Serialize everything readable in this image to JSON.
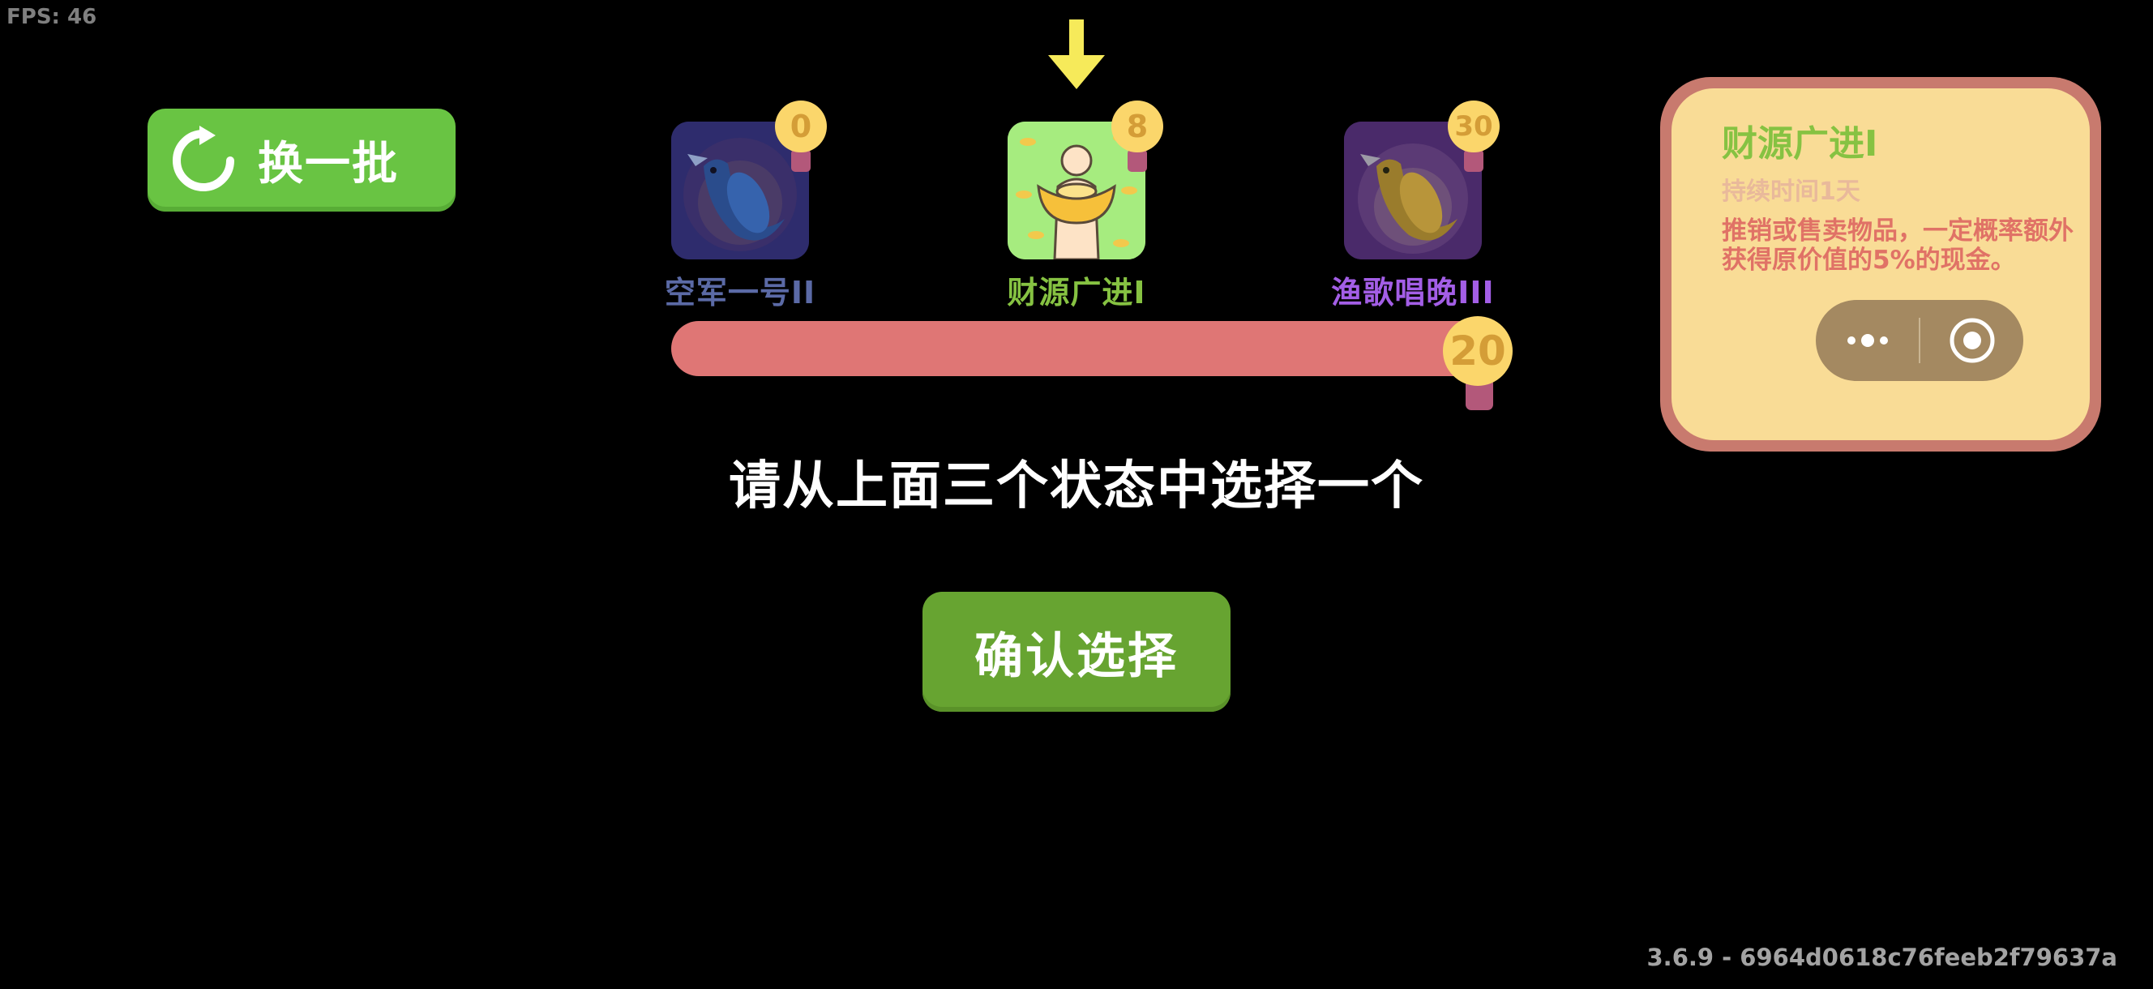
{
  "fps": "FPS: 46",
  "refresh_button": {
    "label": "换一批",
    "icon": "refresh-icon",
    "color": "#69c443"
  },
  "indicator": {
    "icon": "down-arrow-icon",
    "color": "#f6ea5a"
  },
  "cards": [
    {
      "name": "空军一号II",
      "cost": "0",
      "name_color": "#5b6aa6",
      "icon": "blue-fish-icon"
    },
    {
      "name": "财源广进I",
      "cost": "8",
      "name_color": "#86c242",
      "icon": "gold-ingot-icon"
    },
    {
      "name": "渔歌唱晚III",
      "cost": "30",
      "name_color": "#a35ee6",
      "icon": "golden-fish-icon"
    }
  ],
  "progress": {
    "value": "20",
    "fill_fraction": 1.0,
    "color": "#df7675"
  },
  "prompt": "请从上面三个状态中选择一个",
  "confirm_button": {
    "label": "确认选择",
    "color": "#67a431"
  },
  "info_panel": {
    "title": "财源广进I",
    "duration": "持续时间1天",
    "description": "推销或售卖物品，一定概率额外获得原价值的5%的现金。"
  },
  "capsule": {
    "more_icon": "more-dots-icon",
    "close_icon": "target-close-icon"
  },
  "version": "3.6.9 - 6964d0618c76feeb2f79637a"
}
